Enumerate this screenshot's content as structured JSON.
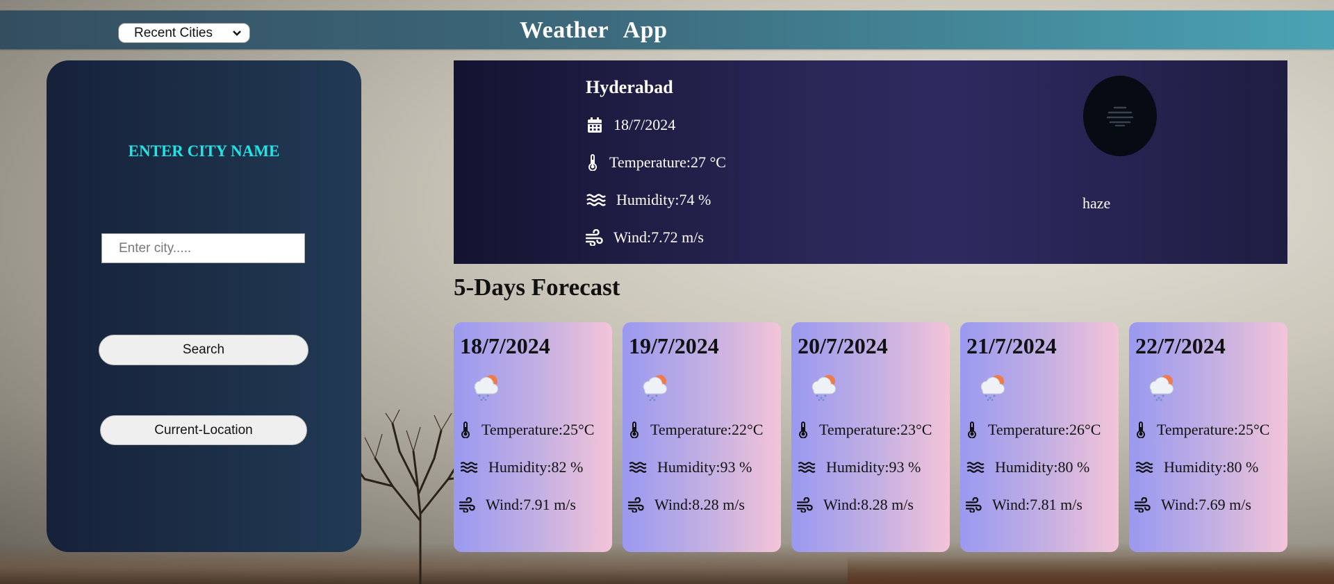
{
  "header": {
    "recent_select": "Recent Cities",
    "title": "Weather App"
  },
  "sidebar": {
    "label": "ENTER CITY NAME",
    "city_placeholder": "Enter city.....",
    "search_button": "Search",
    "location_button": "Current-Location"
  },
  "current": {
    "city": "Hyderabad",
    "date": "18/7/2024",
    "temperature": "Temperature:27 °C",
    "humidity": "Humidity:74 %",
    "wind": "Wind:7.72 m/s",
    "condition": "haze",
    "condition_icon": "haze-icon"
  },
  "forecast": {
    "title": "5-Days Forecast",
    "days": [
      {
        "date": "18/7/2024",
        "temperature": "Temperature:25°C",
        "humidity": "Humidity:82 %",
        "wind": "Wind:7.91 m/s",
        "icon": "rain-cloud-sun-icon"
      },
      {
        "date": "19/7/2024",
        "temperature": "Temperature:22°C",
        "humidity": "Humidity:93 %",
        "wind": "Wind:8.28 m/s",
        "icon": "rain-cloud-sun-icon"
      },
      {
        "date": "20/7/2024",
        "temperature": "Temperature:23°C",
        "humidity": "Humidity:93 %",
        "wind": "Wind:8.28 m/s",
        "icon": "rain-cloud-sun-icon"
      },
      {
        "date": "21/7/2024",
        "temperature": "Temperature:26°C",
        "humidity": "Humidity:80 %",
        "wind": "Wind:7.81 m/s",
        "icon": "rain-cloud-sun-icon"
      },
      {
        "date": "22/7/2024",
        "temperature": "Temperature:25°C",
        "humidity": "Humidity:80 %",
        "wind": "Wind:7.69 m/s",
        "icon": "rain-cloud-sun-icon"
      }
    ]
  },
  "colors": {
    "accent": "#1ee4e6",
    "header_start": "#344e60",
    "header_end": "#4aa3b4",
    "sidebar": "#1d3049",
    "current_panel": "#2a2858"
  }
}
